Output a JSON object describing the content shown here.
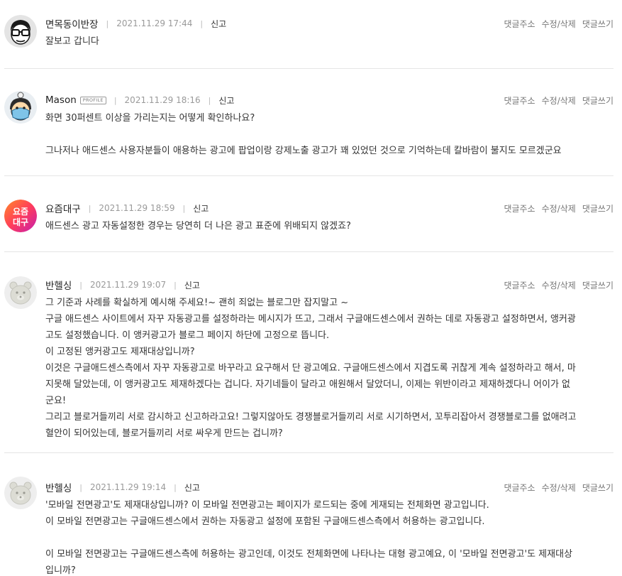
{
  "labels": {
    "profile_badge": "PROFILE",
    "report": "신고",
    "action_address": "댓글주소",
    "action_edit_delete": "수정/삭제",
    "action_reply": "댓글쓰기"
  },
  "comments": [
    {
      "author": "면목동이반장",
      "date": "2021.11.29 17:44",
      "avatar_icon": "glasses-cartoon-avatar-icon",
      "lines": [
        "잘보고 갑니다"
      ]
    },
    {
      "author": "Mason",
      "has_profile_badge": true,
      "date": "2021.11.29 18:16",
      "avatar_icon": "masked-cartoon-avatar-icon",
      "lines": [
        "화면 30퍼센트 이상을 가리는지는 어떻게 확인하나요?",
        "",
        "그나저나 애드센스 사용자분들이 애용하는 광고에 팝업이랑 강제노출 광고가 꽤 있었던 것으로 기억하는데 칼바람이 불지도 모르겠군요"
      ]
    },
    {
      "author": "요즘대구",
      "date": "2021.11.29 18:59",
      "avatar_icon": "yojeum-daegu-logo-icon",
      "avatar_text_top": "요즘",
      "avatar_text_bottom": "대구",
      "lines": [
        "애드센스 광고 자동설정한 경우는 당연히 더 나은 광고 표준에 위배되지 않겠죠?"
      ]
    },
    {
      "author": "반헬싱",
      "date": "2021.11.29 19:07",
      "avatar_icon": "default-bear-avatar-icon",
      "lines": [
        "그 기준과 사례를 확실하게 예시해 주세요!~ 괜히 죄없는 블로그만 잡지말고 ~",
        "구글 애드센스 사이트에서 자꾸 자동광고를 설정하라는 메시지가 뜨고, 그래서 구글애드센스에서 권하는 데로 자동광고 설정하면서, 앵커광",
        "고도 설정했습니다. 이 앵커광고가 블로그 페이지 하단에 고정으로 뜹니다.",
        "이 고정된 앵커광고도 제재대상입니까?",
        "이것은 구글애드센스측에서 자꾸 자동광고로 바꾸라고 요구해서 단 광고예요. 구글애드센스에서 지겹도록 귀찮게 계속 설정하라고 해서, 마",
        "지못해 달았는데, 이 앵커광고도 제재하겠다는 겁니다. 자기네들이 달라고 애원해서 달았더니, 이제는 위반이라고 제재하겠다니 어이가 없",
        "군요!",
        "그리고 블로거들끼리 서로 감시하고 신고하라고요! 그렇지않아도 경쟁블로거들끼리 서로 시기하면서, 꼬투리잡아서 경쟁블로그를 없애려고",
        "혈안이 되어있는데, 블로거들끼리 서로 싸우게 만드는 겁니까?"
      ]
    },
    {
      "author": "반헬싱",
      "date": "2021.11.29 19:14",
      "avatar_icon": "default-bear-avatar-icon",
      "lines": [
        "'모바일 전면광고'도 제재대상입니까? 이 모바일 전면광고는 페이지가 로드되는 중에 게재되는 전체화면 광고입니다.",
        "이 모바일 전면광고는 구글애드센스에서 권하는 자동광고 설정에 포함된 구글애드센스측에서 허용하는 광고입니다.",
        "",
        "이 모바일 전면광고는 구글애드센스측에 허용하는 광고인데, 이것도 전체화면에 나타나는 대형 광고예요, 이 '모바일 전면광고'도 제재대상",
        "입니까?"
      ]
    }
  ]
}
